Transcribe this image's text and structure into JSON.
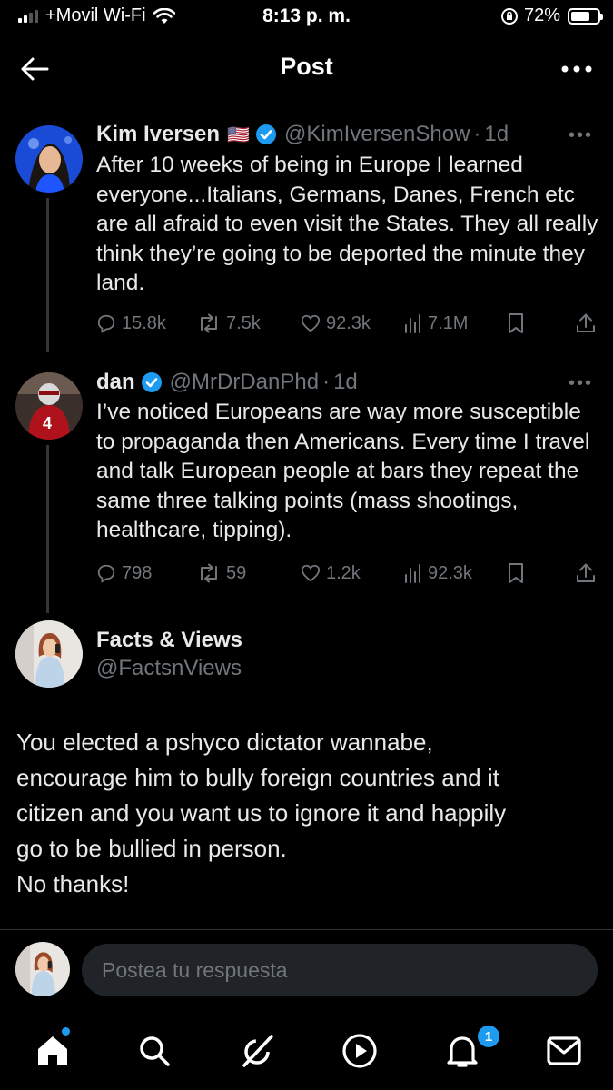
{
  "status_bar": {
    "carrier": "+Movil Wi-Fi",
    "time": "8:13 p. m.",
    "battery": "72%",
    "battery_level": 0.72
  },
  "header": {
    "title": "Post",
    "back_icon": "arrow-left-icon",
    "more_icon": "more-horizontal-icon"
  },
  "thread": [
    {
      "name": "Kim Iversen",
      "flag": "🇺🇸",
      "handle": "@KimIversenShow",
      "time": "1d",
      "text": "After 10 weeks of being in Europe I learned everyone...Italians, Germans, Danes, French etc are all afraid to even visit the States. They all really think they’re going to be deported the minute they land.",
      "replies": "15.8k",
      "reposts": "7.5k",
      "likes": "92.3k",
      "views": "7.1M"
    },
    {
      "name": "dan",
      "handle": "@MrDrDanPhd",
      "time": "1d",
      "text": "I’ve noticed Europeans are way more susceptible to propaganda then Americans. Every time I travel and talk European people at bars they repeat the same three talking points (mass shootings, healthcare, tipping).",
      "replies": "798",
      "reposts": "59",
      "likes": "1.2k",
      "views": "92.3k"
    }
  ],
  "main_post": {
    "name": "Facts & Views",
    "handle": "@FactsnViews",
    "text_lines": [
      "You elected a pshyco dictator wannabe,",
      "encourage him to bully foreign countries and it",
      "citizen and you want us to ignore it and happily",
      "go to be bullied in person.",
      "No thanks!"
    ]
  },
  "reply": {
    "placeholder": "Postea tu respuesta"
  },
  "bottom_nav": {
    "items": [
      "home-icon",
      "search-icon",
      "grok-icon",
      "play-icon",
      "bell-icon",
      "mail-icon"
    ],
    "notification_count": "1"
  },
  "colors": {
    "accent": "#1d9bf0",
    "background": "#000000",
    "secondary_text": "#71767b"
  }
}
